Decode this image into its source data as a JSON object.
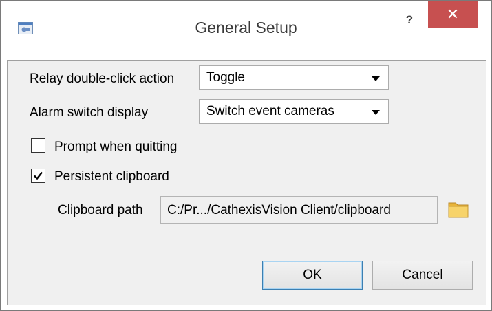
{
  "window": {
    "title": "General Setup",
    "help_label": "?",
    "close_label": "✕",
    "icon": "app-camera-icon"
  },
  "form": {
    "relay_label": "Relay double-click action",
    "relay_value": "Toggle",
    "alarm_label": "Alarm switch display",
    "alarm_value": "Switch event cameras",
    "prompt_label": "Prompt when quitting",
    "prompt_checked": false,
    "persistent_label": "Persistent clipboard",
    "persistent_checked": true,
    "clipboard_path_label": "Clipboard path",
    "clipboard_path_value": "C:/Pr.../CathexisVision Client/clipboard",
    "folder_icon": "folder-icon"
  },
  "buttons": {
    "ok": "OK",
    "cancel": "Cancel"
  },
  "colors": {
    "close_button": "#c75050",
    "client_bg": "#f0f0f0",
    "default_button_border": "#3c7fb1"
  }
}
